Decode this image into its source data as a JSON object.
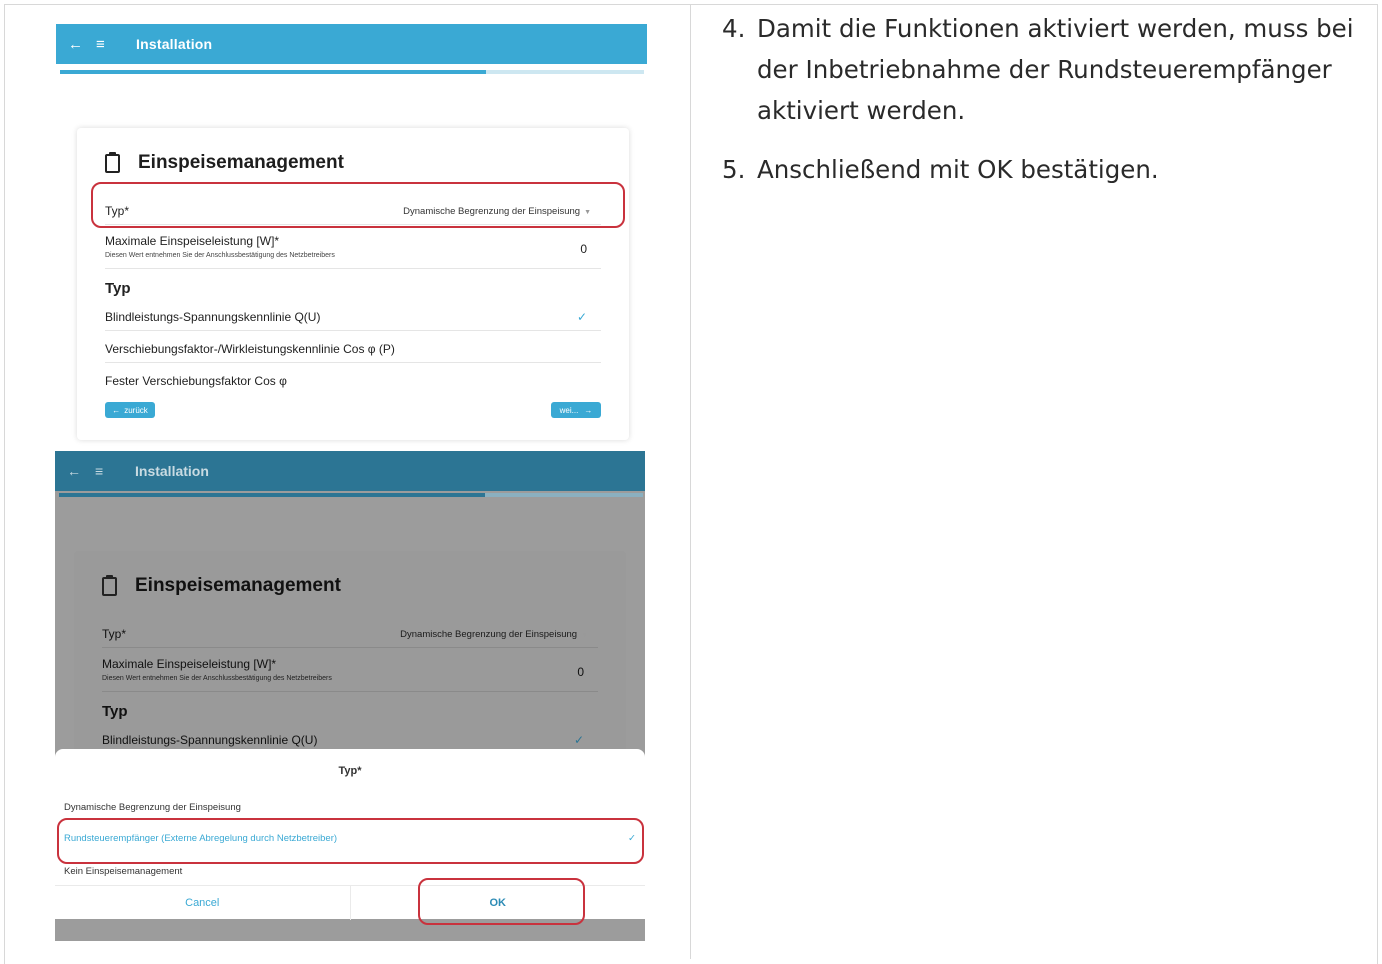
{
  "screen1": {
    "appbar_title": "Installation",
    "card_title": "Einspeisemanagement",
    "typ_label": "Typ*",
    "typ_value": "Dynamische Begrenzung der Einspeisung",
    "max_label": "Maximale Einspeiseleistung [W]*",
    "max_hint": "Diesen Wert entnehmen Sie der Anschlussbestätigung des Netzbetreibers",
    "max_value": "0",
    "section_heading": "Typ",
    "options": [
      "Blindleistungs-Spannungskennlinie Q(U)",
      "Verschiebungsfaktor-/Wirkleistungskennlinie Cos φ (P)",
      "Fester Verschiebungsfaktor Cos φ"
    ],
    "back_button": "zurück",
    "next_button": "wei..."
  },
  "screen2": {
    "appbar_title": "Installation",
    "card_title": "Einspeisemanagement",
    "typ_label": "Typ*",
    "typ_value": "Dynamische Begrenzung der Einspeisung",
    "max_label": "Maximale Einspeiseleistung [W]*",
    "max_hint": "Diesen Wert entnehmen Sie der Anschlussbestätigung des Netzbetreibers",
    "max_value": "0",
    "section_heading": "Typ",
    "option_first": "Blindleistungs-Spannungskennlinie Q(U)",
    "sheet": {
      "title": "Typ*",
      "options": [
        "Dynamische Begrenzung der Einspeisung",
        "Rundsteuerempfänger (Externe Abregelung durch Netzbetreiber)",
        "Kein Einspeisemanagement"
      ],
      "selected_index": 1,
      "cancel": "Cancel",
      "ok": "OK"
    }
  },
  "instructions": [
    {
      "num": "4.",
      "text": "Damit die Funktionen aktiviert werden, muss bei der Inbetriebnahme der Rundsteuerempfänger aktiviert werden."
    },
    {
      "num": "5.",
      "text": "Anschließend mit OK bestätigen."
    }
  ],
  "colors": {
    "accent": "#3aa9d4",
    "highlight": "#c9323d"
  },
  "progress_fraction": 0.73
}
